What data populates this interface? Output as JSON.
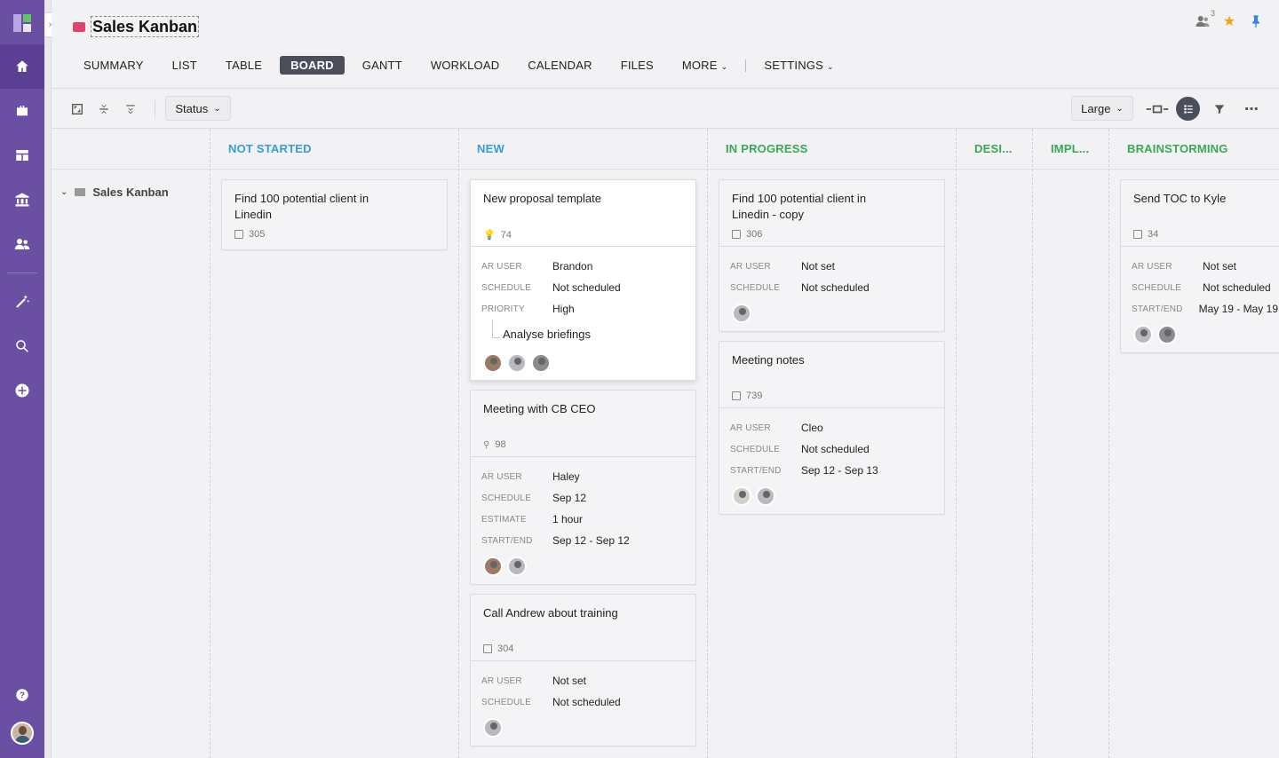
{
  "project": {
    "title": "Sales Kanban",
    "users_count": "3"
  },
  "tabs": [
    {
      "label": "SUMMARY"
    },
    {
      "label": "LIST"
    },
    {
      "label": "TABLE"
    },
    {
      "label": "BOARD"
    },
    {
      "label": "GANTT"
    },
    {
      "label": "WORKLOAD"
    },
    {
      "label": "CALENDAR"
    },
    {
      "label": "FILES"
    }
  ],
  "tab_more": "MORE",
  "tab_settings": "SETTINGS",
  "toolbar": {
    "group_by": "Status",
    "card_size": "Large"
  },
  "tree": {
    "label": "Sales Kanban"
  },
  "columns": [
    {
      "title": "NOT STARTED"
    },
    {
      "title": "NEW"
    },
    {
      "title": "IN PROGRESS"
    },
    {
      "title": "DESI..."
    },
    {
      "title": "IMPL..."
    },
    {
      "title": "BRAINSTORMING"
    }
  ],
  "labels": {
    "ar_user": "AR USER",
    "schedule": "SCHEDULE",
    "priority": "PRIORITY",
    "estimate": "ESTIMATE",
    "start_end": "START/END"
  },
  "cards": {
    "ns1": {
      "title": "Find 100 potential client in Linedin",
      "id": "305"
    },
    "n1": {
      "title": "New proposal template",
      "id": "74",
      "ar_user": "Brandon",
      "schedule": "Not scheduled",
      "priority": "High",
      "subtask": "Analyse briefings"
    },
    "n2": {
      "title": "Meeting with CB CEO",
      "id": "98",
      "ar_user": "Haley",
      "schedule": "Sep 12",
      "estimate": "1 hour",
      "start_end": "Sep 12 - Sep 12"
    },
    "n3": {
      "title": "Call Andrew about training",
      "id": "304",
      "ar_user": "Not set",
      "schedule": "Not scheduled"
    },
    "ip1": {
      "title": "Find 100 potential client in Linedin - copy",
      "id": "306",
      "ar_user": "Not set",
      "schedule": "Not scheduled"
    },
    "ip2": {
      "title": "Meeting notes",
      "id": "739",
      "ar_user": "Cleo",
      "schedule": "Not scheduled",
      "start_end": "Sep 12 - Sep 13"
    },
    "b1": {
      "title": "Send TOC to Kyle",
      "id": "34",
      "ar_user": "Not set",
      "schedule": "Not scheduled",
      "start_end": "May 19 - May 19"
    }
  },
  "colors": {
    "rail": "#6b4fa3",
    "blue_status": "#3a9ad9",
    "green_status": "#3aa757",
    "active_tab": "#4a4f5b",
    "star": "#f0a21a",
    "pin": "#3b82e0"
  }
}
